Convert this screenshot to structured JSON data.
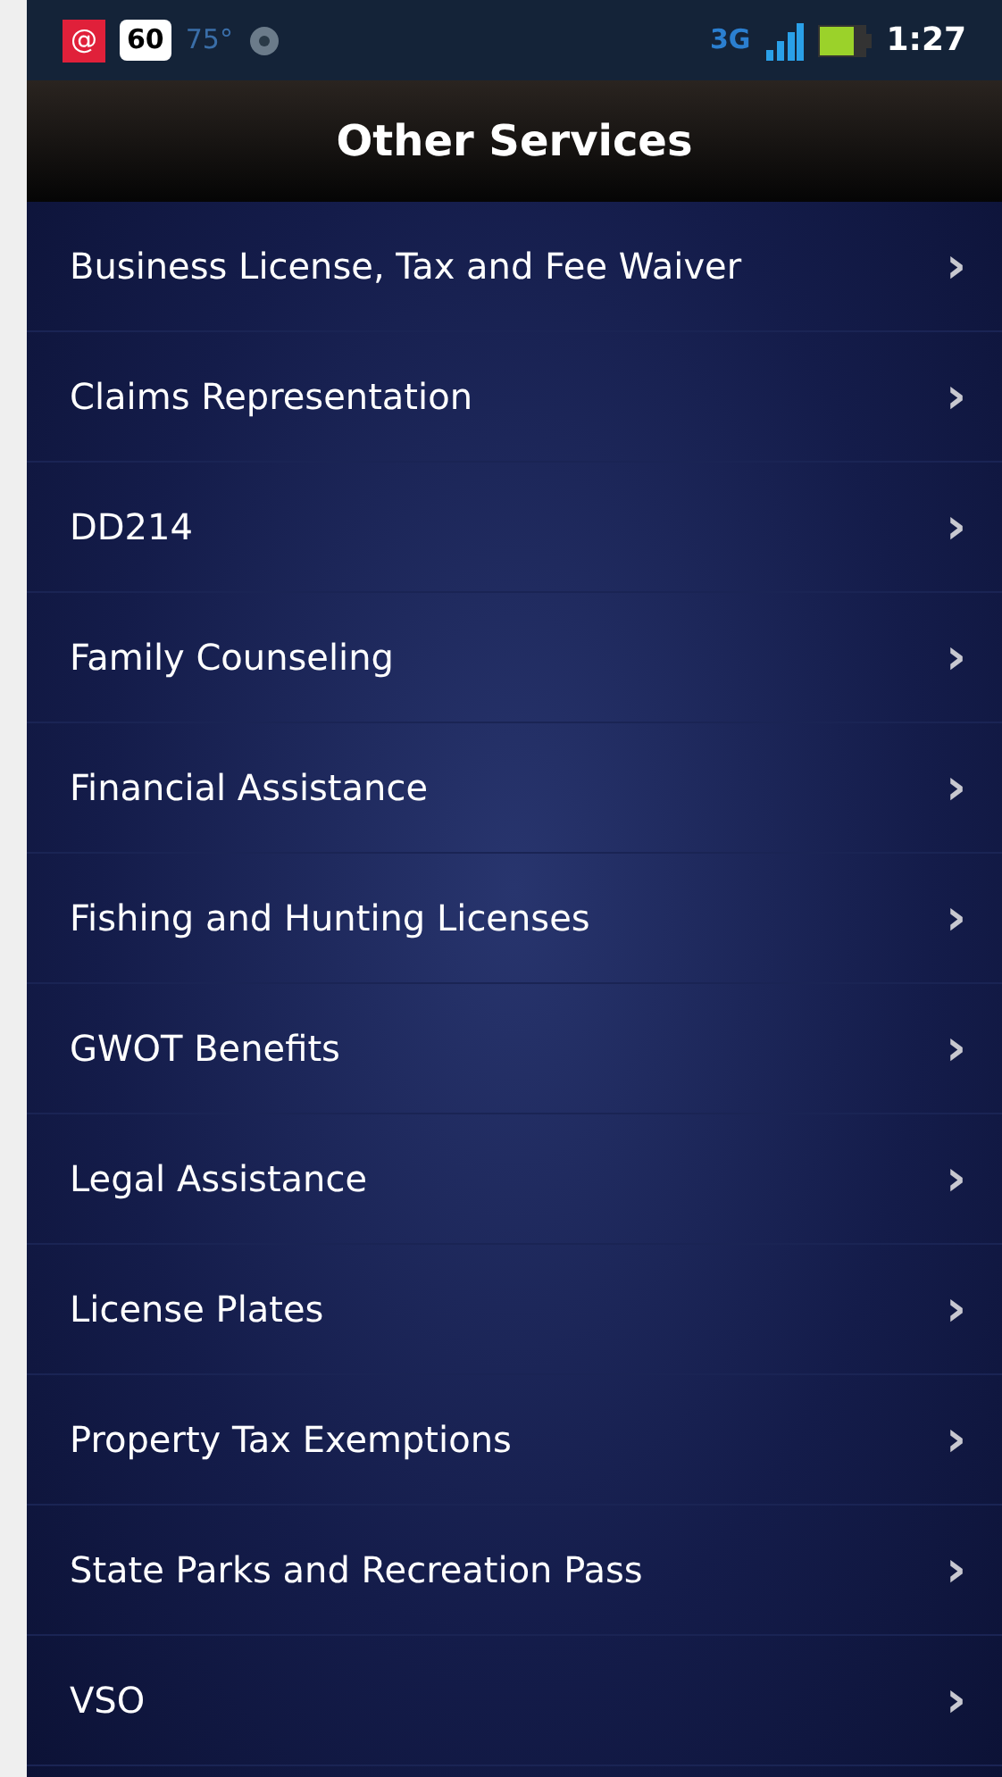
{
  "status_bar": {
    "app_icon": "@",
    "badge": "60",
    "temperature": "75°",
    "network": "3G",
    "time": "1:27"
  },
  "title": "Other Services",
  "items": [
    {
      "label": "Business License, Tax and Fee Waiver",
      "chevron": "›"
    },
    {
      "label": "Claims Representation",
      "chevron": "›"
    },
    {
      "label": "DD214",
      "chevron": "›"
    },
    {
      "label": "Family Counseling",
      "chevron": "›"
    },
    {
      "label": "Financial Assistance",
      "chevron": "›"
    },
    {
      "label": "Fishing and Hunting Licenses",
      "chevron": "›"
    },
    {
      "label": "GWOT Benefits",
      "chevron": "›"
    },
    {
      "label": "Legal Assistance",
      "chevron": "›"
    },
    {
      "label": "License Plates",
      "chevron": "›"
    },
    {
      "label": "Property Tax Exemptions",
      "chevron": "›"
    },
    {
      "label": "State Parks and Recreation Pass",
      "chevron": "›"
    },
    {
      "label": "VSO",
      "chevron": "›"
    }
  ]
}
